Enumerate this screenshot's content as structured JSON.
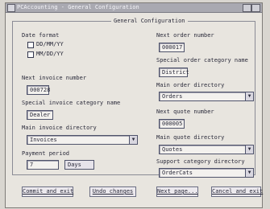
{
  "window": {
    "title": "PCAccounting - General Configuration"
  },
  "frame": {
    "title": "General Configuration"
  },
  "date_format": {
    "label": "Date format",
    "options": [
      "DD/MM/YY",
      "MM/DD/YY"
    ],
    "selected": "DD/MM/YY"
  },
  "invoice": {
    "next_number_label": "Next invoice number",
    "next_number_value": "000728",
    "special_category_label": "Special invoice category name",
    "special_category_value": "Dealer",
    "directory_label": "Main invoice directory",
    "directory_value": "Invoices"
  },
  "payment": {
    "label": "Payment period",
    "value": "7",
    "unit": "Days"
  },
  "order": {
    "next_number_label": "Next order number",
    "next_number_value": "000017",
    "special_category_label": "Special order category name",
    "special_category_value": "District",
    "directory_label": "Main order directory",
    "directory_value": "Orders"
  },
  "quote": {
    "next_number_label": "Next quote number",
    "next_number_value": "000005",
    "directory_label": "Main quote directory",
    "directory_value": "Quotes"
  },
  "support": {
    "directory_label": "Support category directory",
    "directory_value": "OrderCats"
  },
  "buttons": {
    "commit": "Commit and exit",
    "undo": "Undo changes",
    "next_page": "Next page...",
    "cancel": "Cancel and exit"
  },
  "icons": {
    "dropdown": "chevron-down-icon",
    "system_menu": "system-menu-icon"
  },
  "colors": {
    "titlebar": "#a9a9b1",
    "window_bg": "#e8e5df",
    "field_border": "#4f536b"
  }
}
